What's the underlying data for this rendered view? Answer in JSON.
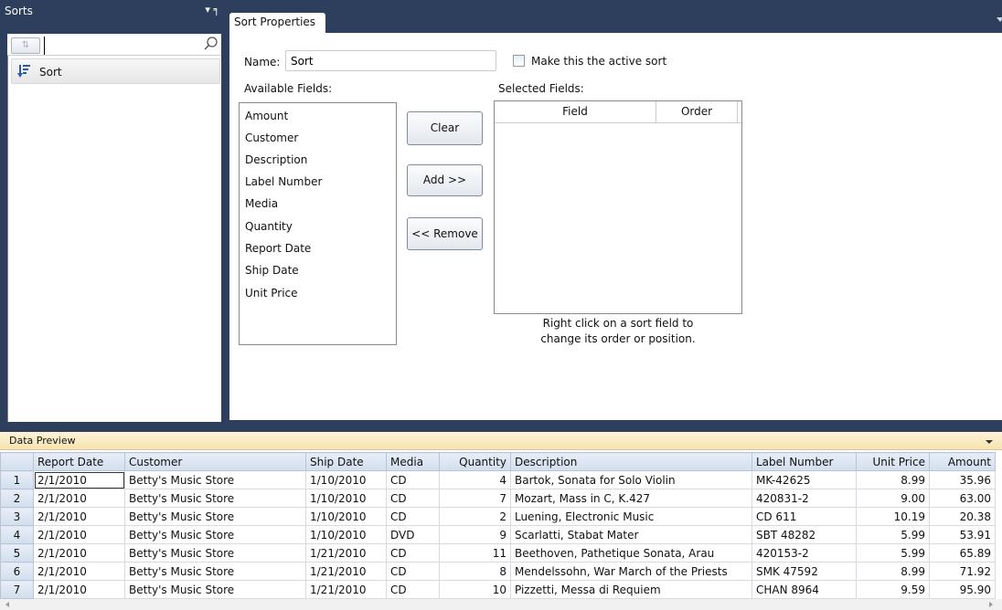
{
  "sorts_panel": {
    "title": "Sorts",
    "pin_icons": "▾ ╕",
    "toggle_icon": "⇅",
    "search_value": "",
    "items": [
      {
        "label": "Sort",
        "icon": "sort-descending-icon"
      }
    ]
  },
  "properties": {
    "tab_label": "Sort Properties",
    "name_label": "Name:",
    "name_value": "Sort",
    "active_checkbox_label": "Make this the active sort",
    "active_checked": false,
    "available_label": "Available Fields:",
    "available_fields": [
      "Amount",
      "Customer",
      "Description",
      "Label Number",
      "Media",
      "Quantity",
      "Report Date",
      "Ship Date",
      "Unit Price"
    ],
    "clear_label": "Clear",
    "add_label": "Add >>",
    "remove_label": "<< Remove",
    "selected_label": "Selected Fields:",
    "selected_columns": [
      "Field",
      "Order"
    ],
    "hint_line1": "Right click on a sort field to",
    "hint_line2": "change its order or position."
  },
  "preview": {
    "title": "Data Preview",
    "columns": [
      "Report Date",
      "Customer",
      "Ship Date",
      "Media",
      "Quantity",
      "Description",
      "Label Number",
      "Unit Price",
      "Amount"
    ],
    "rows": [
      [
        "1",
        "2/1/2010",
        "Betty's Music Store",
        "1/10/2010",
        "CD",
        "4",
        "Bartok, Sonata for Solo Violin",
        "MK-42625",
        "8.99",
        "35.96"
      ],
      [
        "2",
        "2/1/2010",
        "Betty's Music Store",
        "1/10/2010",
        "CD",
        "7",
        "Mozart, Mass in C, K.427",
        "420831-2",
        "9.00",
        "63.00"
      ],
      [
        "3",
        "2/1/2010",
        "Betty's Music Store",
        "1/10/2010",
        "CD",
        "2",
        "Luening, Electronic Music",
        "CD 611",
        "10.19",
        "20.38"
      ],
      [
        "4",
        "2/1/2010",
        "Betty's Music Store",
        "1/10/2010",
        "DVD",
        "9",
        "Scarlatti, Stabat Mater",
        "SBT 48282",
        "5.99",
        "53.91"
      ],
      [
        "5",
        "2/1/2010",
        "Betty's Music Store",
        "1/21/2010",
        "CD",
        "11",
        "Beethoven, Pathetique Sonata, Arau",
        "420153-2",
        "5.99",
        "65.89"
      ],
      [
        "6",
        "2/1/2010",
        "Betty's Music Store",
        "1/21/2010",
        "CD",
        "8",
        "Mendelssohn, War March of the Priests",
        "SMK 47592",
        "8.99",
        "71.92"
      ],
      [
        "7",
        "2/1/2010",
        "Betty's Music Store",
        "1/21/2010",
        "CD",
        "10",
        "Pizzetti, Messa di Requiem",
        "CHAN 8964",
        "9.59",
        "95.90"
      ]
    ]
  },
  "colors": {
    "frame": "#2d3f5d",
    "preview_header": "#f6e3b0",
    "grid_header": "#d3deed"
  }
}
